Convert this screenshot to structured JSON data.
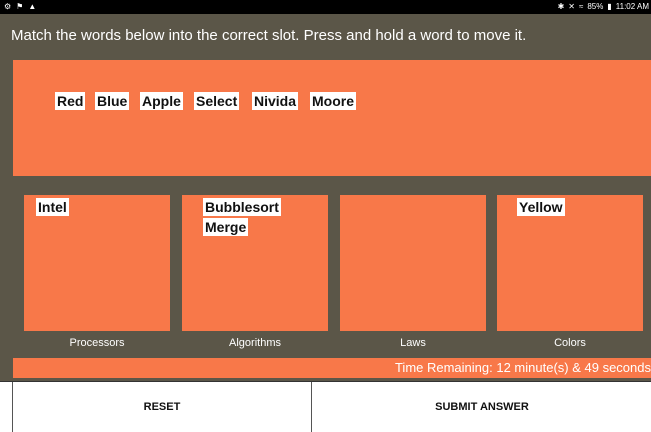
{
  "status_bar": {
    "left_icons": [
      "settings-icon",
      "flag-icon",
      "warning-icon"
    ],
    "bluetooth": "✱",
    "mute": "✕",
    "wifi": "≈",
    "battery": "85%",
    "time": "11:02 AM"
  },
  "instruction": "Match the words below into the correct slot. Press and hold a word to move it.",
  "word_bank": [
    "Red",
    "Blue",
    "Apple",
    "Select",
    "Nivida",
    "Moore"
  ],
  "slots": [
    {
      "label": "Processors",
      "words": [
        "Intel"
      ]
    },
    {
      "label": "Algorithms",
      "words": [
        "Bubblesort",
        "Merge"
      ]
    },
    {
      "label": "Laws",
      "words": []
    },
    {
      "label": "Colors",
      "words": [
        "Yellow"
      ]
    }
  ],
  "timer": "Time Remaining: 12 minute(s) & 49 seconds",
  "buttons": {
    "reset": "RESET",
    "submit": "SUBMIT ANSWER"
  },
  "colors": {
    "accent": "#f87849",
    "background": "#5b5648"
  }
}
